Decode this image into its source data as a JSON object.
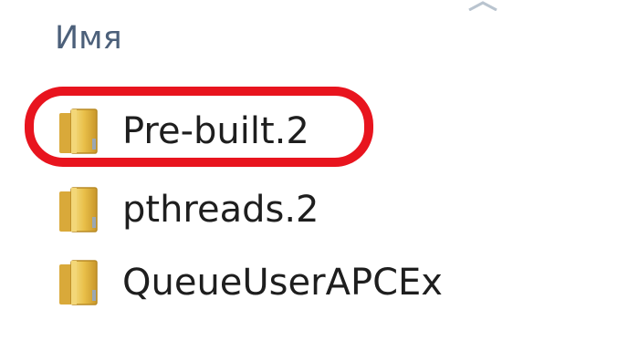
{
  "header": {
    "name_column_label": "Имя",
    "sort_icon": "sort-ascending-icon"
  },
  "files": [
    {
      "name": "Pre-built.2",
      "icon": "folder-icon",
      "selected": true
    },
    {
      "name": "pthreads.2",
      "icon": "folder-icon",
      "selected": false
    },
    {
      "name": "QueueUserAPCEx",
      "icon": "folder-icon",
      "selected": false
    }
  ],
  "annotation": {
    "highlight_color": "#e8141e",
    "highlighted_item": "Pre-built.2"
  }
}
